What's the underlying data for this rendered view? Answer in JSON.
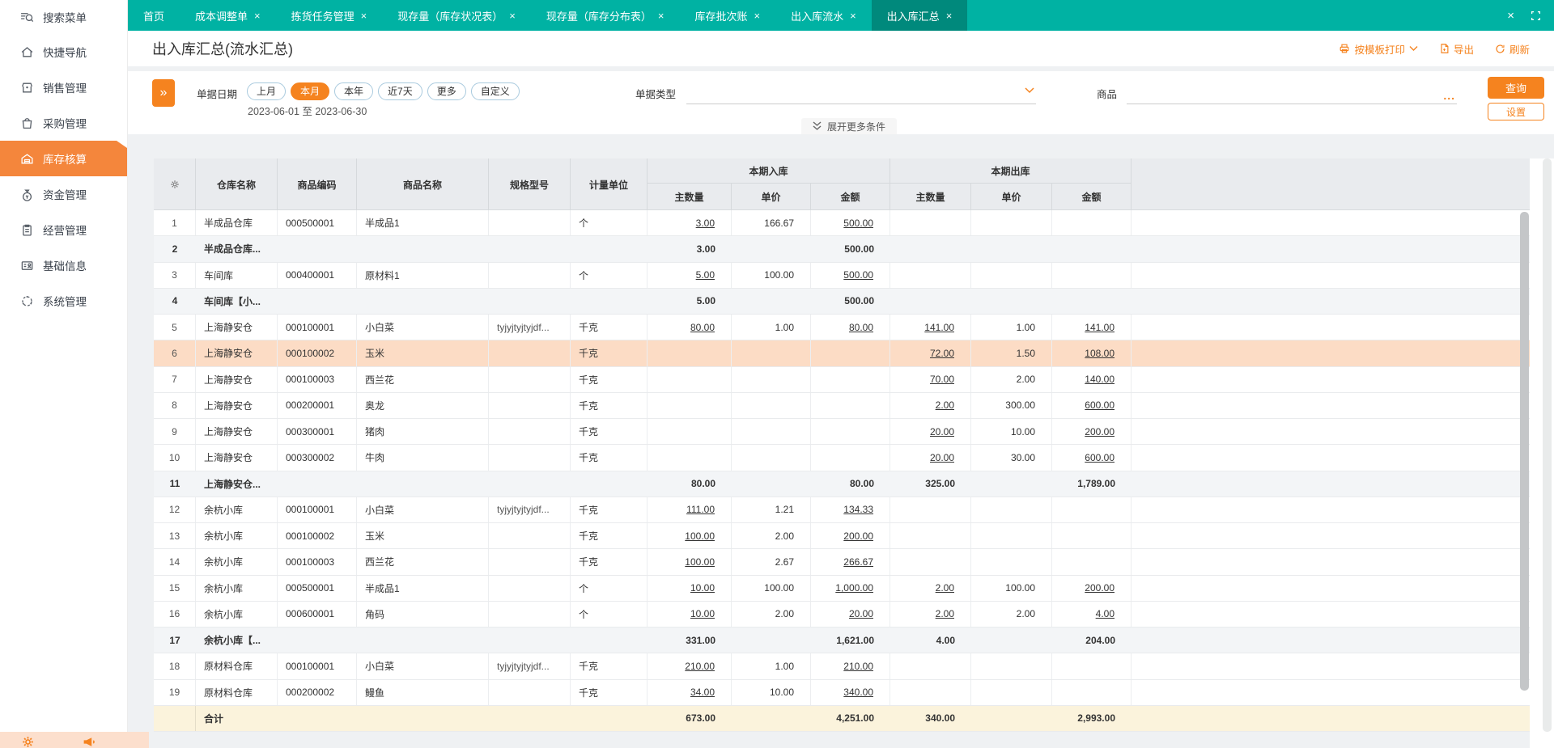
{
  "colors": {
    "teal": "#00b2a3",
    "teal_dark": "#00897c",
    "orange": "#f5831f",
    "sidebar_active": "#f4863c",
    "highlight": "#fcdcc5",
    "group_row": "#f3f5f7",
    "total_row": "#fbf3dc",
    "header_bg": "#e9ebee"
  },
  "sidebar": {
    "items": [
      {
        "label": "搜索菜单",
        "icon": "menu-search-icon"
      },
      {
        "label": "快捷导航",
        "icon": "home-icon"
      },
      {
        "label": "销售管理",
        "icon": "shop-icon"
      },
      {
        "label": "采购管理",
        "icon": "bag-icon"
      },
      {
        "label": "库存核算",
        "icon": "warehouse-icon"
      },
      {
        "label": "资金管理",
        "icon": "money-pouch-icon"
      },
      {
        "label": "经营管理",
        "icon": "clipboard-icon"
      },
      {
        "label": "基础信息",
        "icon": "id-card-icon"
      },
      {
        "label": "系统管理",
        "icon": "dashed-circle-icon"
      }
    ],
    "active_index": 4,
    "footer_icons": [
      "gear-icon",
      "megaphone-icon"
    ]
  },
  "tabs": {
    "items": [
      {
        "label": "首页",
        "closable": false
      },
      {
        "label": "成本调整单",
        "closable": true
      },
      {
        "label": "拣货任务管理",
        "closable": true
      },
      {
        "label": "现存量（库存状况表）",
        "closable": true
      },
      {
        "label": "现存量（库存分布表）",
        "closable": true
      },
      {
        "label": "库存批次账",
        "closable": true
      },
      {
        "label": "出入库流水",
        "closable": true
      },
      {
        "label": "出入库汇总",
        "closable": true
      }
    ],
    "active_index": 7,
    "close_glyph": "×"
  },
  "page": {
    "title": "出入库汇总(流水汇总)",
    "actions": [
      {
        "label": "按模板打印",
        "icon": "printer-icon",
        "has_dropdown": true
      },
      {
        "label": "导出",
        "icon": "export-icon"
      },
      {
        "label": "刷新",
        "icon": "refresh-icon"
      }
    ]
  },
  "filters": {
    "collapse_glyph": "»",
    "date_label": "单据日期",
    "date_options": [
      "上月",
      "本月",
      "本年",
      "近7天",
      "更多",
      "自定义"
    ],
    "date_selected": "本月",
    "date_range": "2023-06-01 至 2023-06-30",
    "doc_type_label": "单据类型",
    "doc_type_value": "",
    "product_label": "商品",
    "product_value": "",
    "product_more_glyph": "...",
    "query_button": "查询",
    "settings_button": "设置",
    "expand_button": "展开更多条件"
  },
  "table": {
    "col_groups": {
      "in": "本期入库",
      "out": "本期出库"
    },
    "columns": [
      "仓库名称",
      "商品编码",
      "商品名称",
      "规格型号",
      "计量单位",
      "主数量",
      "单价",
      "金额",
      "主数量",
      "单价",
      "金额"
    ],
    "rows": [
      {
        "type": "data",
        "no": "1",
        "warehouse": "半成品仓库",
        "code": "000500001",
        "name": "半成品1",
        "spec": "",
        "unit": "个",
        "iq": "3.00",
        "ip": "166.67",
        "ia": "500.00",
        "oq": "",
        "op": "",
        "oa": ""
      },
      {
        "type": "group",
        "no": "2",
        "warehouse": "半成品仓库...",
        "code": "",
        "name": "",
        "spec": "",
        "unit": "",
        "iq": "3.00",
        "ip": "",
        "ia": "500.00",
        "oq": "",
        "op": "",
        "oa": ""
      },
      {
        "type": "data",
        "no": "3",
        "warehouse": "车间库",
        "code": "000400001",
        "name": "原材料1",
        "spec": "",
        "unit": "个",
        "iq": "5.00",
        "ip": "100.00",
        "ia": "500.00",
        "oq": "",
        "op": "",
        "oa": ""
      },
      {
        "type": "group",
        "no": "4",
        "warehouse": "车间库【小...",
        "code": "",
        "name": "",
        "spec": "",
        "unit": "",
        "iq": "5.00",
        "ip": "",
        "ia": "500.00",
        "oq": "",
        "op": "",
        "oa": ""
      },
      {
        "type": "data",
        "no": "5",
        "warehouse": "上海静安仓",
        "code": "000100001",
        "name": "小白菜",
        "spec": "tyjyjtyjtyjdf...",
        "unit": "千克",
        "iq": "80.00",
        "ip": "1.00",
        "ia": "80.00",
        "oq": "141.00",
        "op": "1.00",
        "oa": "141.00"
      },
      {
        "type": "highlight",
        "no": "6",
        "warehouse": "上海静安仓",
        "code": "000100002",
        "name": "玉米",
        "spec": "",
        "unit": "千克",
        "iq": "",
        "ip": "",
        "ia": "",
        "oq": "72.00",
        "op": "1.50",
        "oa": "108.00"
      },
      {
        "type": "data",
        "no": "7",
        "warehouse": "上海静安仓",
        "code": "000100003",
        "name": "西兰花",
        "spec": "",
        "unit": "千克",
        "iq": "",
        "ip": "",
        "ia": "",
        "oq": "70.00",
        "op": "2.00",
        "oa": "140.00"
      },
      {
        "type": "data",
        "no": "8",
        "warehouse": "上海静安仓",
        "code": "000200001",
        "name": "奥龙",
        "spec": "",
        "unit": "千克",
        "iq": "",
        "ip": "",
        "ia": "",
        "oq": "2.00",
        "op": "300.00",
        "oa": "600.00"
      },
      {
        "type": "data",
        "no": "9",
        "warehouse": "上海静安仓",
        "code": "000300001",
        "name": "猪肉",
        "spec": "",
        "unit": "千克",
        "iq": "",
        "ip": "",
        "ia": "",
        "oq": "20.00",
        "op": "10.00",
        "oa": "200.00"
      },
      {
        "type": "data",
        "no": "10",
        "warehouse": "上海静安仓",
        "code": "000300002",
        "name": "牛肉",
        "spec": "",
        "unit": "千克",
        "iq": "",
        "ip": "",
        "ia": "",
        "oq": "20.00",
        "op": "30.00",
        "oa": "600.00"
      },
      {
        "type": "group",
        "no": "11",
        "warehouse": "上海静安仓...",
        "code": "",
        "name": "",
        "spec": "",
        "unit": "",
        "iq": "80.00",
        "ip": "",
        "ia": "80.00",
        "oq": "325.00",
        "op": "",
        "oa": "1,789.00"
      },
      {
        "type": "data",
        "no": "12",
        "warehouse": "余杭小库",
        "code": "000100001",
        "name": "小白菜",
        "spec": "tyjyjtyjtyjdf...",
        "unit": "千克",
        "iq": "111.00",
        "ip": "1.21",
        "ia": "134.33",
        "oq": "",
        "op": "",
        "oa": ""
      },
      {
        "type": "data",
        "no": "13",
        "warehouse": "余杭小库",
        "code": "000100002",
        "name": "玉米",
        "spec": "",
        "unit": "千克",
        "iq": "100.00",
        "ip": "2.00",
        "ia": "200.00",
        "oq": "",
        "op": "",
        "oa": ""
      },
      {
        "type": "data",
        "no": "14",
        "warehouse": "余杭小库",
        "code": "000100003",
        "name": "西兰花",
        "spec": "",
        "unit": "千克",
        "iq": "100.00",
        "ip": "2.67",
        "ia": "266.67",
        "oq": "",
        "op": "",
        "oa": ""
      },
      {
        "type": "data",
        "no": "15",
        "warehouse": "余杭小库",
        "code": "000500001",
        "name": "半成品1",
        "spec": "",
        "unit": "个",
        "iq": "10.00",
        "ip": "100.00",
        "ia": "1,000.00",
        "oq": "2.00",
        "op": "100.00",
        "oa": "200.00"
      },
      {
        "type": "data",
        "no": "16",
        "warehouse": "余杭小库",
        "code": "000600001",
        "name": "角码",
        "spec": "",
        "unit": "个",
        "iq": "10.00",
        "ip": "2.00",
        "ia": "20.00",
        "oq": "2.00",
        "op": "2.00",
        "oa": "4.00"
      },
      {
        "type": "group",
        "no": "17",
        "warehouse": "余杭小库【...",
        "code": "",
        "name": "",
        "spec": "",
        "unit": "",
        "iq": "331.00",
        "ip": "",
        "ia": "1,621.00",
        "oq": "4.00",
        "op": "",
        "oa": "204.00"
      },
      {
        "type": "data",
        "no": "18",
        "warehouse": "原材料仓库",
        "code": "000100001",
        "name": "小白菜",
        "spec": "tyjyjtyjtyjdf...",
        "unit": "千克",
        "iq": "210.00",
        "ip": "1.00",
        "ia": "210.00",
        "oq": "",
        "op": "",
        "oa": ""
      },
      {
        "type": "data",
        "no": "19",
        "warehouse": "原材料仓库",
        "code": "000200002",
        "name": "鳗鱼",
        "spec": "",
        "unit": "千克",
        "iq": "34.00",
        "ip": "10.00",
        "ia": "340.00",
        "oq": "",
        "op": "",
        "oa": ""
      }
    ],
    "total_row": {
      "type": "total",
      "no": "",
      "warehouse": "合计",
      "code": "",
      "name": "",
      "spec": "",
      "unit": "",
      "iq": "673.00",
      "ip": "",
      "ia": "4,251.00",
      "oq": "340.00",
      "op": "",
      "oa": "2,993.00"
    }
  }
}
